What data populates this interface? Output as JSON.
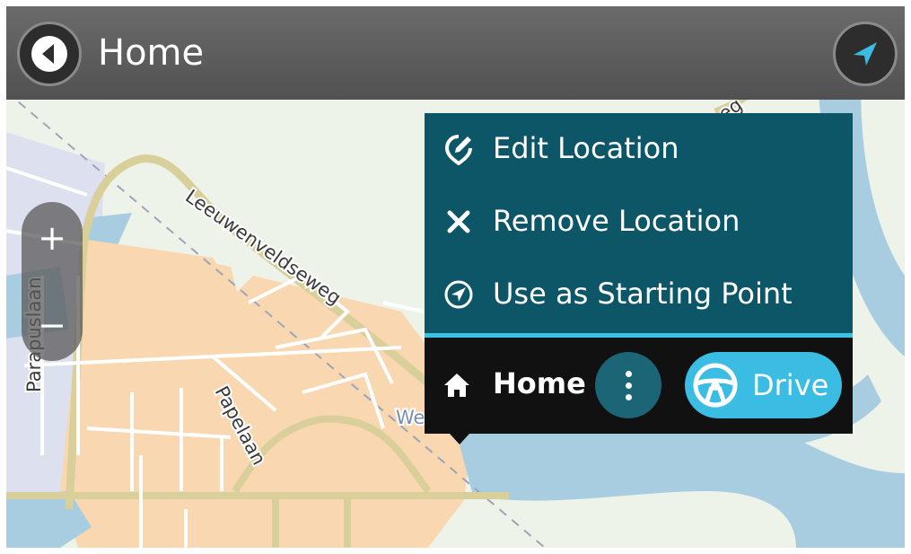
{
  "header": {
    "title": "Home",
    "back_icon": "back-arrow-icon",
    "location_icon": "current-location-arrow-icon"
  },
  "map": {
    "street_labels": {
      "leeuwenveldseweg": "Leeuwenveldseweg",
      "papelaan": "Papelaan",
      "parapuslaan": "Parapuslaan",
      "partial_we": "We",
      "partial_eg": "eg"
    },
    "colors": {
      "water": "#a9cde0",
      "built_area": "#f8d7b1",
      "road": "#d9cf9a",
      "land": "#eef3ea"
    }
  },
  "zoom": {
    "zoom_in_label": "+",
    "zoom_out_label": "−"
  },
  "popup": {
    "menu_items": [
      {
        "label": "Edit Location",
        "icon": "edit-location-icon"
      },
      {
        "label": "Remove Location",
        "icon": "close-icon"
      },
      {
        "label": "Use as Starting Point",
        "icon": "starting-point-icon"
      }
    ],
    "footer": {
      "title": "Home",
      "home_icon": "home-icon",
      "more_icon": "more-vertical-icon",
      "drive_label": "Drive",
      "drive_icon": "steering-wheel-icon"
    },
    "colors": {
      "menu_background": "#0d5667",
      "divider": "#3bc3e6",
      "footer_background": "#111111",
      "drive_button": "#3bbde3"
    }
  }
}
